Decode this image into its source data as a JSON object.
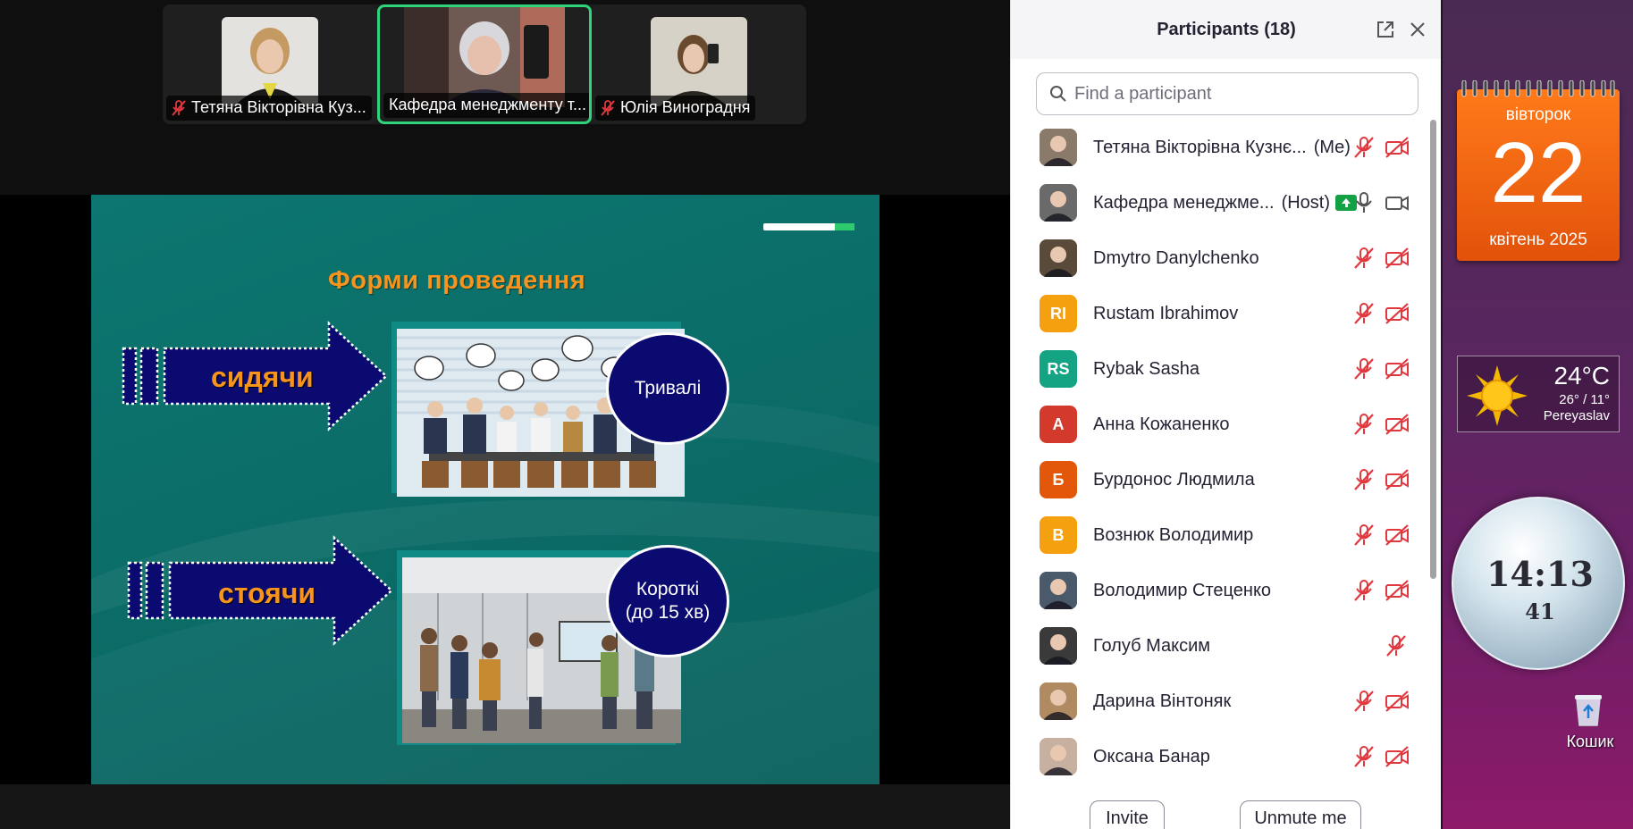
{
  "video_strip": {
    "tiles": [
      {
        "name": "Тетяна Вікторівна Куз...",
        "muted": true
      },
      {
        "name": "Кафедра менеджменту т...",
        "muted": false,
        "active": true
      },
      {
        "name": "Юлія Виноградня",
        "muted": true
      }
    ]
  },
  "slide": {
    "title": "Форми проведення",
    "row1": {
      "label": "сидячи",
      "oval": "Тривалі"
    },
    "row2": {
      "label": "стоячи",
      "oval": "Короткі\n(до 15 хв)"
    }
  },
  "participants_panel": {
    "title": "Participants (18)",
    "search_placeholder": "Find a participant",
    "participants": [
      {
        "name": "Тетяна Вікторівна Кузнє...",
        "tag": "(Me)",
        "avatar_initials": "",
        "avatar_color": "#8a7a6a",
        "mic": "muted",
        "cam": "off"
      },
      {
        "name": "Кафедра менеджме...",
        "tag": "(Host)",
        "avatar_initials": "",
        "avatar_color": "#6a6a6a",
        "mic": "on",
        "cam": "on",
        "sharing": true
      },
      {
        "name": "Dmytro Danylchenko",
        "tag": "",
        "avatar_initials": "",
        "avatar_color": "#5a4a3a",
        "mic": "muted",
        "cam": "off"
      },
      {
        "name": "Rustam Ibrahimov",
        "tag": "",
        "avatar_initials": "RI",
        "avatar_color": "#f5a00f",
        "mic": "muted",
        "cam": "off"
      },
      {
        "name": "Rybak Sasha",
        "tag": "",
        "avatar_initials": "RS",
        "avatar_color": "#14a383",
        "mic": "muted",
        "cam": "off"
      },
      {
        "name": "Анна Кожаненко",
        "tag": "",
        "avatar_initials": "А",
        "avatar_color": "#d33a2c",
        "mic": "muted",
        "cam": "off"
      },
      {
        "name": "Бурдонос Людмила",
        "tag": "",
        "avatar_initials": "Б",
        "avatar_color": "#e2570a",
        "mic": "muted",
        "cam": "off"
      },
      {
        "name": "Вознюк Володимир",
        "tag": "",
        "avatar_initials": "В",
        "avatar_color": "#f5a00f",
        "mic": "muted",
        "cam": "off"
      },
      {
        "name": "Володимир Стеценко",
        "tag": "",
        "avatar_initials": "",
        "avatar_color": "#4a5a6a",
        "mic": "muted",
        "cam": "off"
      },
      {
        "name": "Голуб Максим",
        "tag": "",
        "avatar_initials": "",
        "avatar_color": "#3a3a3a",
        "mic": "none",
        "cam": "muted-only"
      },
      {
        "name": "Дарина Вінтоняк",
        "tag": "",
        "avatar_initials": "",
        "avatar_color": "#b08a60",
        "mic": "muted",
        "cam": "off"
      },
      {
        "name": "Оксана Банар",
        "tag": "",
        "avatar_initials": "",
        "avatar_color": "#c8b0a0",
        "mic": "muted",
        "cam": "off"
      }
    ],
    "buttons": {
      "invite": "Invite",
      "unmute": "Unmute me"
    }
  },
  "desktop": {
    "calendar": {
      "weekday": "вівторок",
      "day": "22",
      "month_year": "квітень 2025"
    },
    "weather": {
      "temp": "24°C",
      "range": "26° / 11°",
      "city": "Pereyaslav"
    },
    "clock": {
      "time": "14:13",
      "seconds": "41"
    },
    "recycle_bin": {
      "label": "Кошик"
    }
  },
  "colors": {
    "accent_green": "#2ed47a",
    "muted_red": "#e0383e",
    "slide_teal": "#0b6b66",
    "slide_orange": "#f7941d",
    "oval_navy": "#0a0a70"
  }
}
